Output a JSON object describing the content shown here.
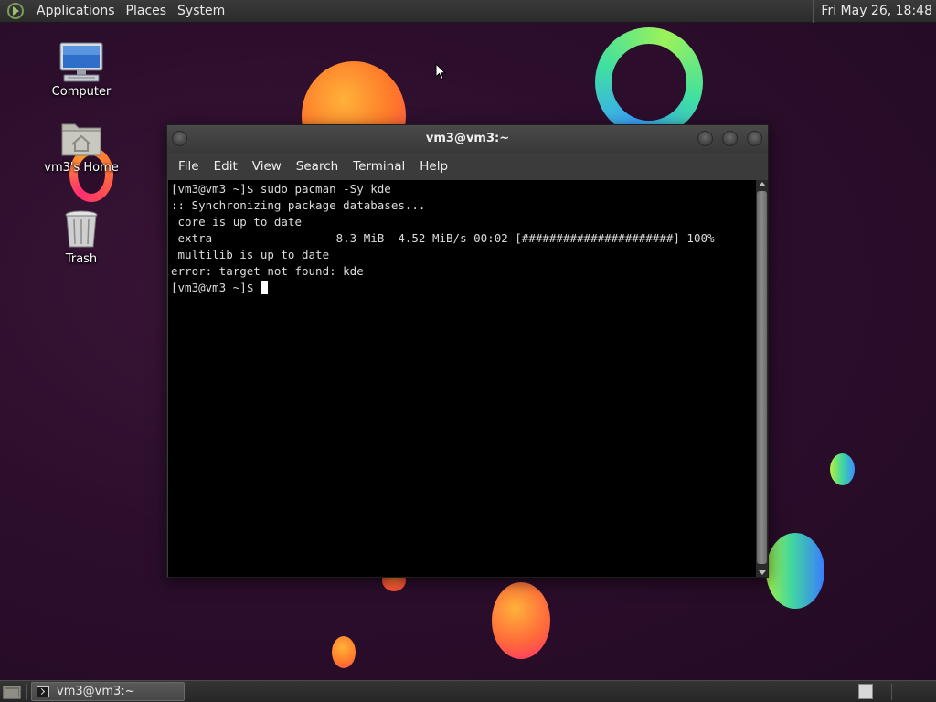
{
  "top_panel": {
    "menus": [
      "Applications",
      "Places",
      "System"
    ],
    "clock": "Fri May 26, 18:48"
  },
  "desktop_icons": {
    "computer": "Computer",
    "home": "vm3's Home",
    "trash": "Trash"
  },
  "terminal": {
    "title": "vm3@vm3:~",
    "menu": [
      "File",
      "Edit",
      "View",
      "Search",
      "Terminal",
      "Help"
    ],
    "lines": [
      "[vm3@vm3 ~]$ sudo pacman -Sy kde",
      ":: Synchronizing package databases...",
      " core is up to date",
      " extra                  8.3 MiB  4.52 MiB/s 00:02 [######################] 100%",
      " multilib is up to date",
      "error: target not found: kde"
    ],
    "prompt": "[vm3@vm3 ~]$ "
  },
  "taskbar": {
    "window_label": "vm3@vm3:~"
  },
  "colors": {
    "background": "#2c0e2c",
    "panel": "#2b2b2b",
    "terminal_bg": "#000000",
    "terminal_fg": "#dcdcdc"
  }
}
